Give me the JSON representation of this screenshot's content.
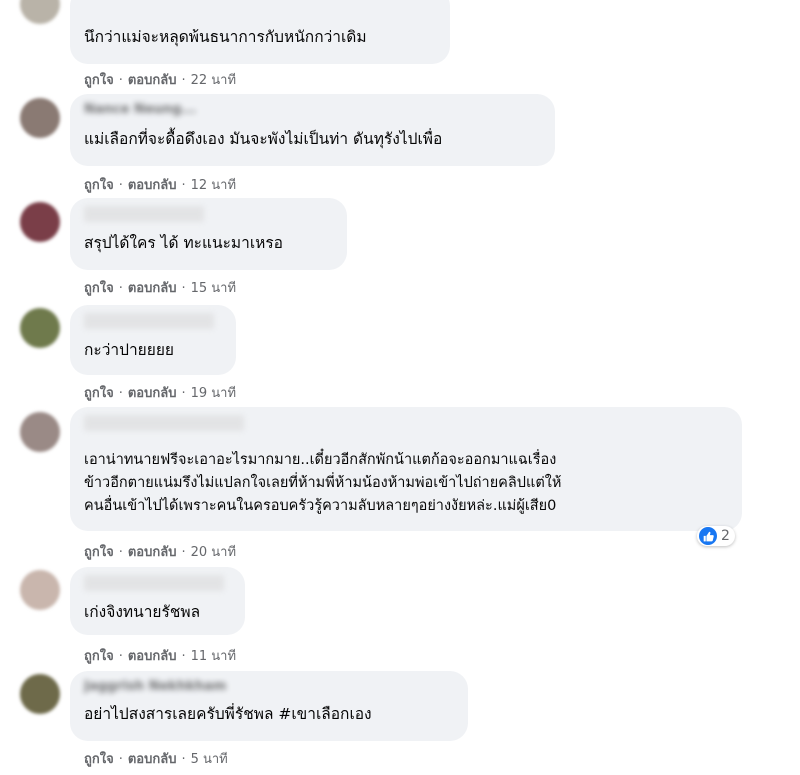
{
  "actions": {
    "like": "ถูกใจ",
    "reply": "ตอบกลับ",
    "dot": "·"
  },
  "comments": [
    {
      "name": "",
      "text": "นึกว่าแม่จะหลุดพ้นธนาการกับหนักกว่าเดิม",
      "time": "22 นาที",
      "avatar_color": "#b9b3a8"
    },
    {
      "name": "Nance Neung...",
      "text": "แม่เลือกที่จะดื้อดึงเอง มันจะพังไม่เป็นท่า ดันทุรังไปเพื่อ",
      "time": "12 นาที",
      "avatar_color": "#8a7a73"
    },
    {
      "name": "",
      "text": "สรุปได้ใคร ได้ ทะแนะมาเหรอ",
      "time": "15 นาที",
      "avatar_color": "#7a3e48"
    },
    {
      "name": "",
      "text": "กะว่าปายยยย",
      "time": "19 นาที",
      "avatar_color": "#6f7a4c"
    },
    {
      "name": "",
      "text": "เอาน่าทนายฟรีจะเอาอะไรมากมาย..เดี๋ยวอีกสักพักน้าแตก้อจะออกมาแฉเรื่อง\nข้าวอีกตายแน่มรึงไม่แปลกใจเลยที่ห้ามพี่ห้ามน้องห้ามพ่อเข้าไปถ่ายคลิปแต่ให้\nคนอื่นเข้าไปได้เพราะคนในครอบครัวรู้ความลับหลายๆอย่างงัยหล่ะ.แม่ผู้เสีย0",
      "time": "20 นาที",
      "avatar_color": "#9a8a86",
      "reactions": "2"
    },
    {
      "name": "",
      "text": "เก่งจิงทนายรัชพล",
      "time": "11 นาที",
      "avatar_color": "#c9b6ad"
    },
    {
      "name": "Jaggrish Nekhkham",
      "text": "อย่าไปสงสารเลยครับพี่รัชพล #เขาเลือกเอง",
      "time": "5 นาที",
      "avatar_color": "#6e6a4a"
    }
  ]
}
